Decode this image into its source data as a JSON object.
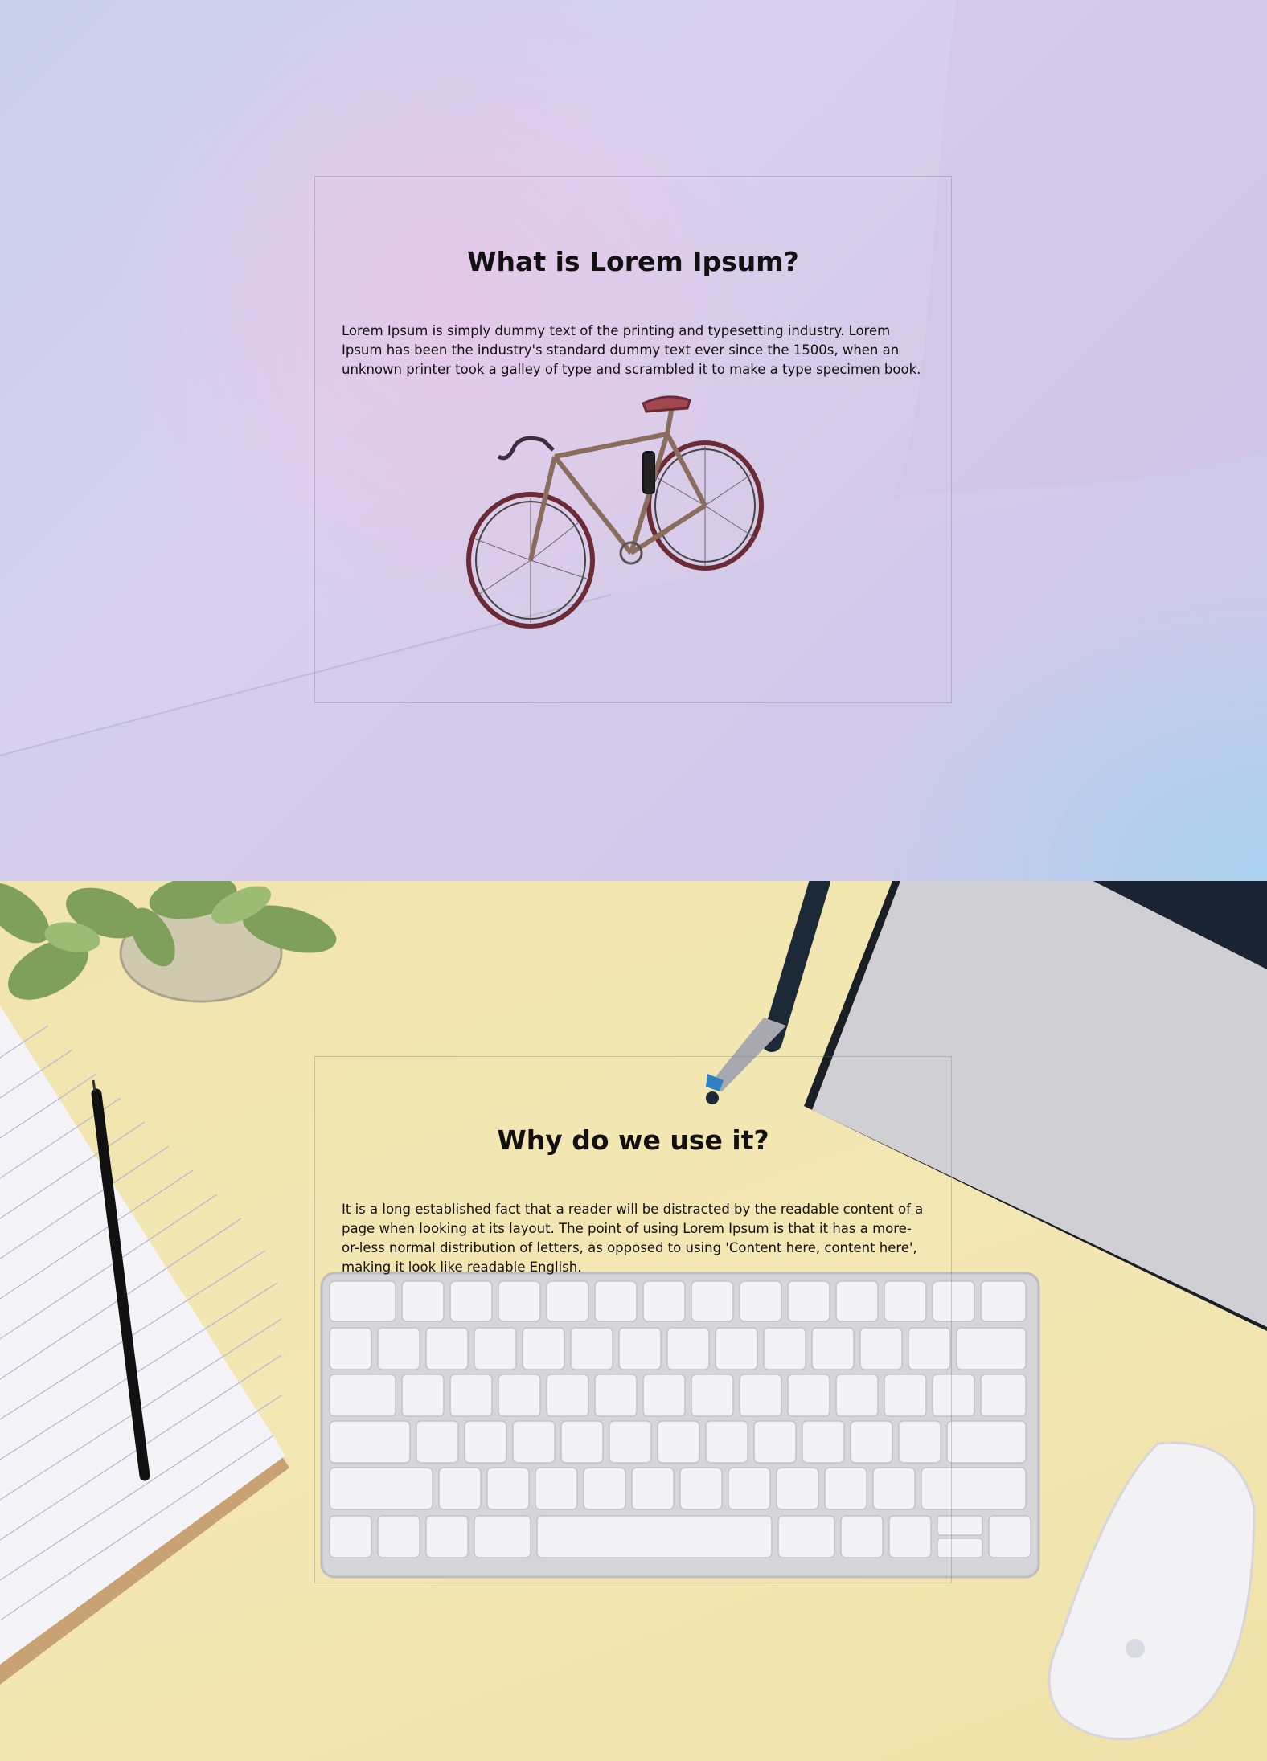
{
  "sections": [
    {
      "heading": "What is Lorem Ipsum?",
      "body": "Lorem Ipsum is simply dummy text of the printing and typesetting industry. Lorem Ipsum has been the industry's standard dummy text ever since the 1500s, when an unknown printer took a galley of type and scrambled it to make a type specimen book."
    },
    {
      "heading": "Why do we use it?",
      "body": "It is a long established fact that a reader will be distracted by the readable content of a page when looking at its layout. The point of using Lorem Ipsum is that it has a more-or-less normal distribution of letters, as opposed to using 'Content here, content here', making it look like readable English."
    }
  ]
}
